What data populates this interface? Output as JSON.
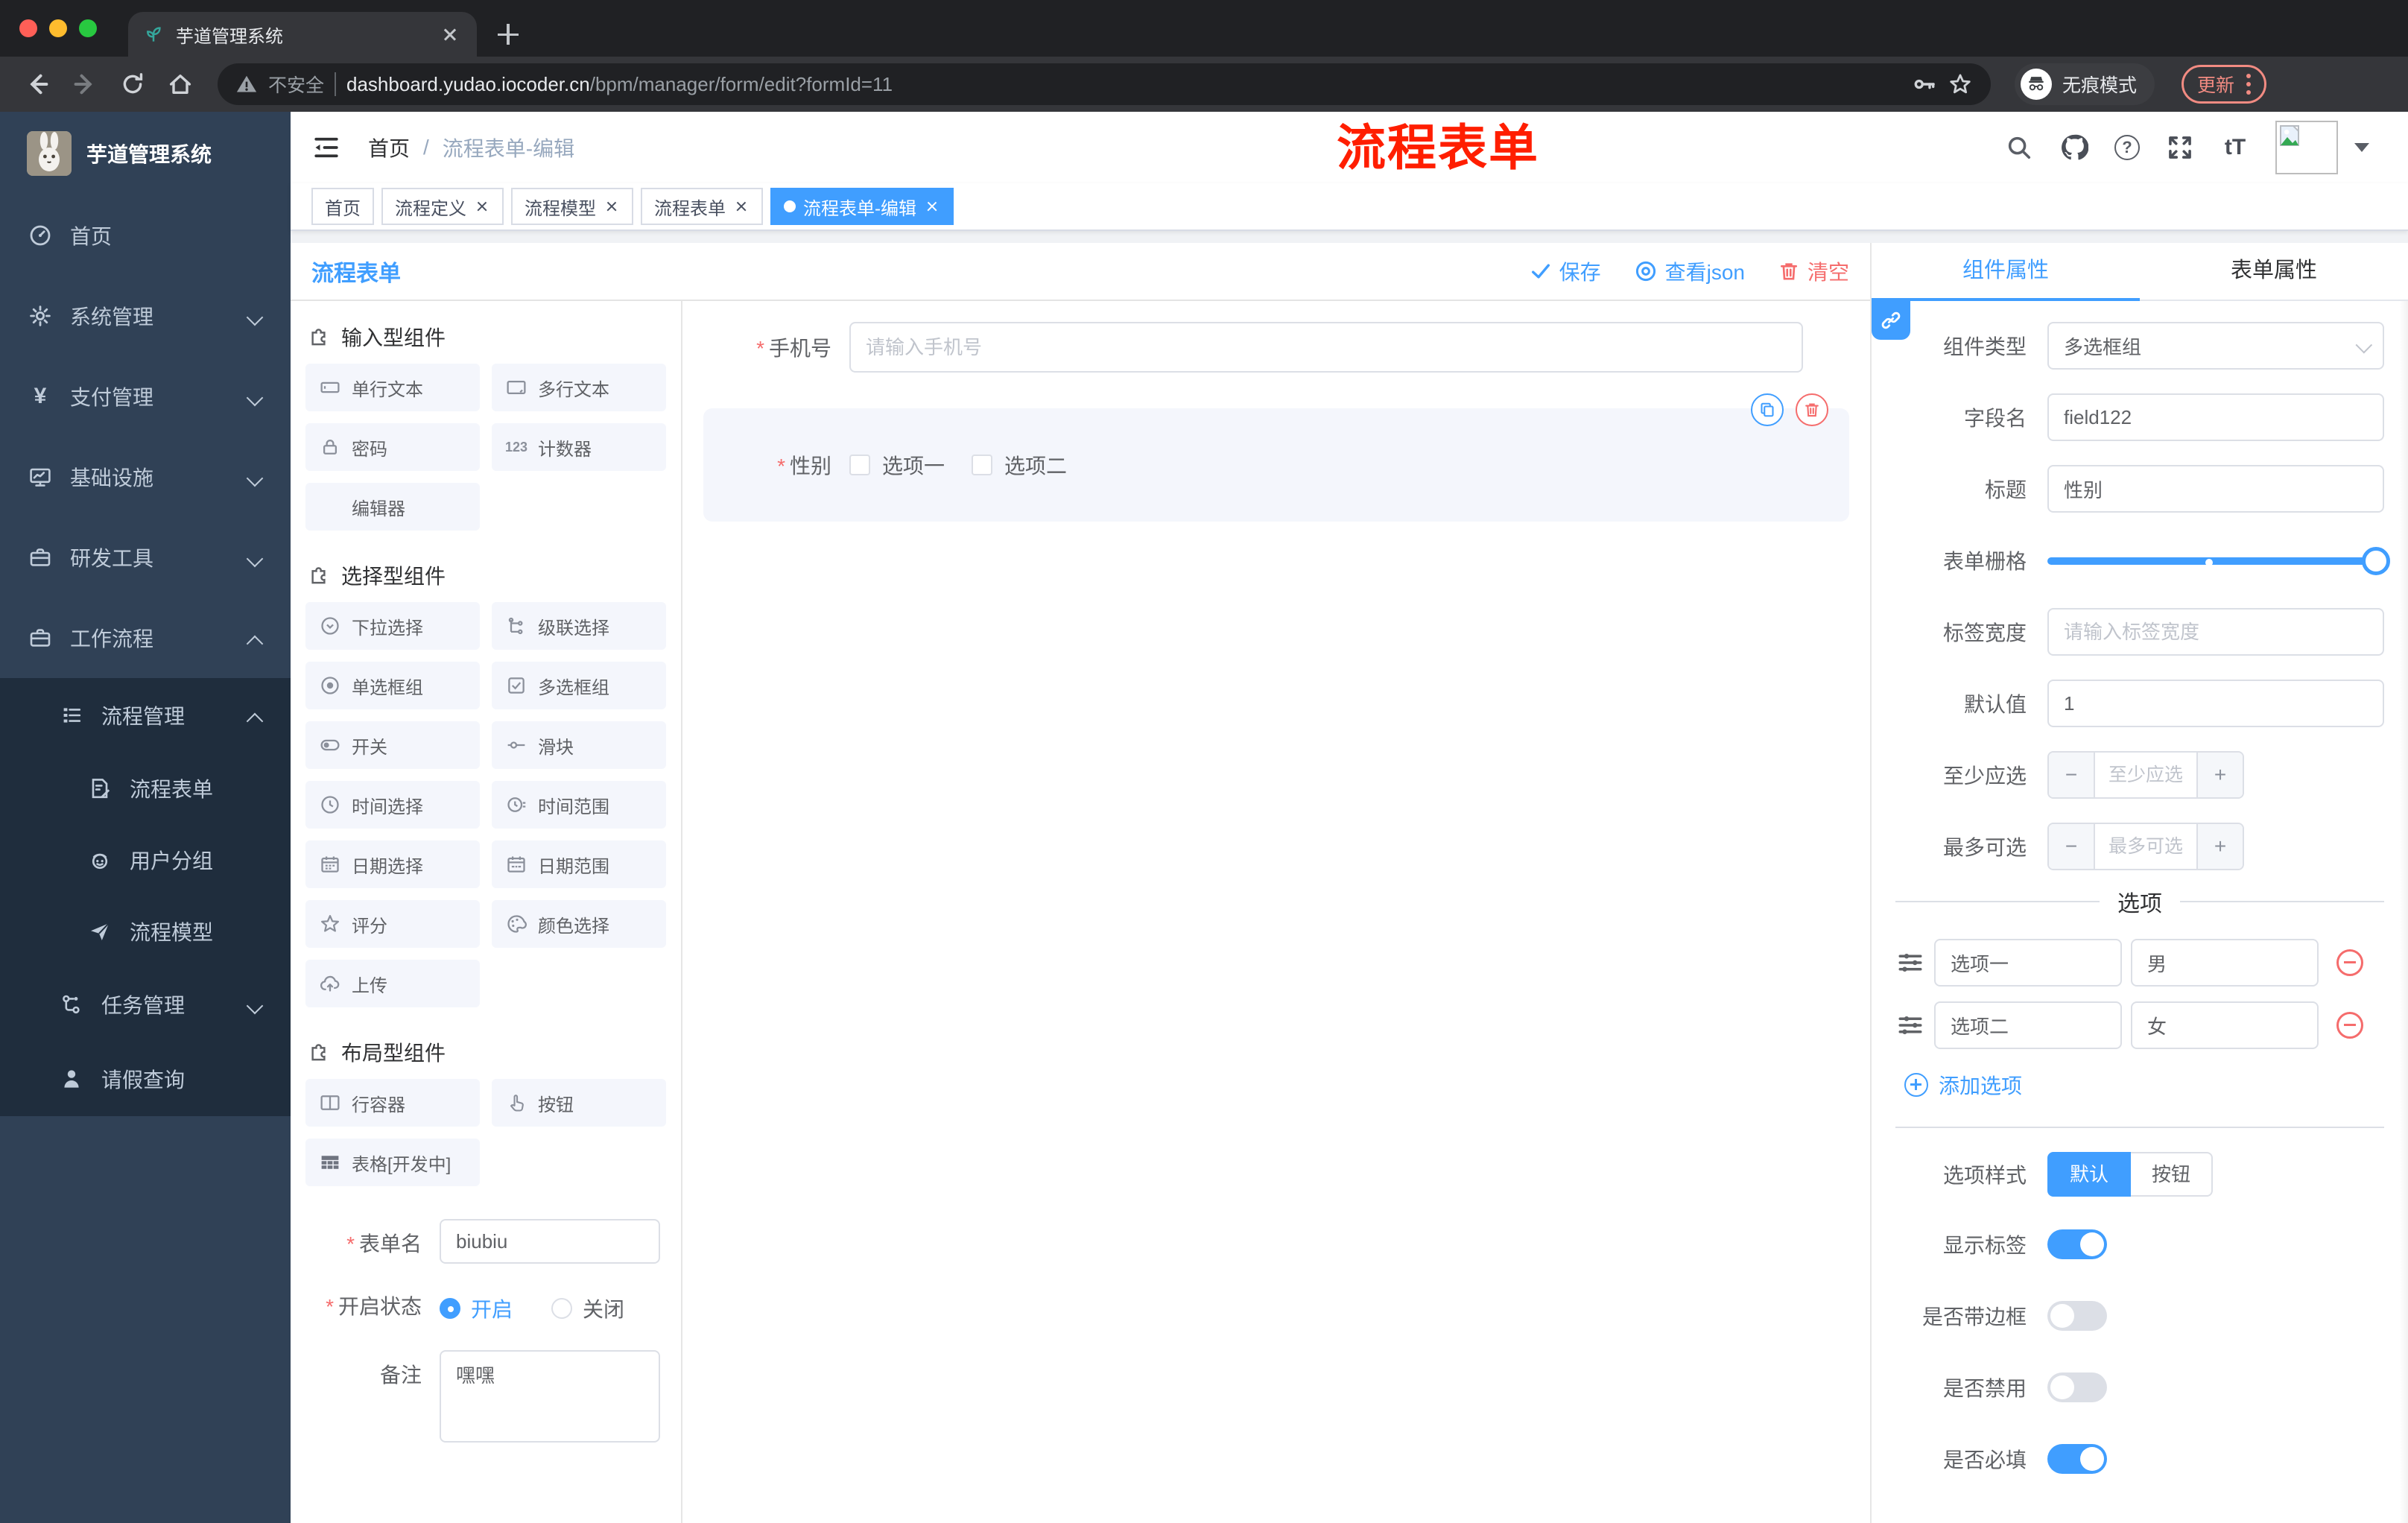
{
  "browser": {
    "tab_title": "芋道管理系统",
    "security_label": "不安全",
    "url_host": "dashboard.yudao.iocoder.cn",
    "url_path": "/bpm/manager/form/edit?formId=11",
    "incognito_label": "无痕模式",
    "update_label": "更新"
  },
  "sidebar": {
    "logo_title": "芋道管理系统",
    "items": [
      {
        "label": "首页",
        "icon": "dashboard-icon"
      },
      {
        "label": "系统管理",
        "icon": "gear-icon",
        "chevron": "down"
      },
      {
        "label": "支付管理",
        "icon": "yen-icon",
        "chevron": "down"
      },
      {
        "label": "基础设施",
        "icon": "monitor-icon",
        "chevron": "down"
      },
      {
        "label": "研发工具",
        "icon": "briefcase-icon",
        "chevron": "down"
      },
      {
        "label": "工作流程",
        "icon": "briefcase-icon",
        "chevron": "up"
      },
      {
        "label": "流程管理",
        "icon": "list-tree-icon",
        "chevron": "up",
        "level": 2
      },
      {
        "label": "流程表单",
        "icon": "form-doc-icon",
        "level": 3
      },
      {
        "label": "用户分组",
        "icon": "user-face-icon",
        "level": 3
      },
      {
        "label": "流程模型",
        "icon": "send-icon",
        "level": 3
      },
      {
        "label": "任务管理",
        "icon": "tree-icon",
        "chevron": "down",
        "level": 2
      },
      {
        "label": "请假查询",
        "icon": "person-icon",
        "level": 2
      }
    ]
  },
  "navbar": {
    "breadcrumb_home": "首页",
    "breadcrumb_sep": "/",
    "breadcrumb_current": "流程表单-编辑",
    "annotation": "流程表单",
    "help_glyph": "?",
    "text_size_glyph": "tT"
  },
  "tags": [
    {
      "label": "首页",
      "closable": false,
      "active": false
    },
    {
      "label": "流程定义",
      "closable": true,
      "active": false
    },
    {
      "label": "流程模型",
      "closable": true,
      "active": false
    },
    {
      "label": "流程表单",
      "closable": true,
      "active": false
    },
    {
      "label": "流程表单-编辑",
      "closable": true,
      "active": true
    }
  ],
  "toolbar": {
    "title": "流程表单",
    "save_label": "保存",
    "view_json_label": "查看json",
    "clear_label": "清空"
  },
  "components": {
    "sections": [
      {
        "title": "输入型组件",
        "items": [
          {
            "label": "单行文本",
            "icon": "input-icon"
          },
          {
            "label": "多行文本",
            "icon": "textarea-icon"
          },
          {
            "label": "密码",
            "icon": "lock-icon"
          },
          {
            "label": "计数器",
            "icon": "counter-123-icon"
          },
          {
            "label": "编辑器",
            "icon": "none"
          }
        ]
      },
      {
        "title": "选择型组件",
        "items": [
          {
            "label": "下拉选择",
            "icon": "select-icon"
          },
          {
            "label": "级联选择",
            "icon": "cascader-icon"
          },
          {
            "label": "单选框组",
            "icon": "radio-icon"
          },
          {
            "label": "多选框组",
            "icon": "checkbox-icon"
          },
          {
            "label": "开关",
            "icon": "switch-icon"
          },
          {
            "label": "滑块",
            "icon": "slider-icon"
          },
          {
            "label": "时间选择",
            "icon": "time-icon"
          },
          {
            "label": "时间范围",
            "icon": "time-range-icon"
          },
          {
            "label": "日期选择",
            "icon": "date-icon"
          },
          {
            "label": "日期范围",
            "icon": "date-range-icon"
          },
          {
            "label": "评分",
            "icon": "star-icon"
          },
          {
            "label": "颜色选择",
            "icon": "palette-icon"
          },
          {
            "label": "上传",
            "icon": "upload-icon"
          }
        ]
      },
      {
        "title": "布局型组件",
        "items": [
          {
            "label": "行容器",
            "icon": "row-container-icon"
          },
          {
            "label": "按钮",
            "icon": "button-hand-icon"
          },
          {
            "label": "表格[开发中]",
            "icon": "table-icon"
          }
        ]
      }
    ],
    "counter_glyph": "123",
    "meta": {
      "name_label": "表单名",
      "name_value": "biubiu",
      "status_label": "开启状态",
      "status_on": "开启",
      "status_off": "关闭",
      "remark_label": "备注",
      "remark_value": "嘿嘿"
    }
  },
  "canvas": {
    "phone_label": "手机号",
    "phone_placeholder": "请输入手机号",
    "gender_label": "性别",
    "gender_options": [
      "选项一",
      "选项二"
    ]
  },
  "props": {
    "tab_component": "组件属性",
    "tab_form": "表单属性",
    "type_label": "组件类型",
    "type_value": "多选框组",
    "field_label": "字段名",
    "field_value": "field122",
    "title_label": "标题",
    "title_value": "性别",
    "grid_label": "表单栅格",
    "label_width_label": "标签宽度",
    "label_width_placeholder": "请输入标签宽度",
    "default_label": "默认值",
    "default_value": "1",
    "min_label": "至少应选",
    "min_placeholder": "至少应选",
    "max_label": "最多可选",
    "max_placeholder": "最多可选",
    "stepper_minus": "−",
    "stepper_plus": "+",
    "options_divider": "选项",
    "options": [
      {
        "label": "选项一",
        "value": "男"
      },
      {
        "label": "选项二",
        "value": "女"
      }
    ],
    "add_option": "添加选项",
    "style_label": "选项样式",
    "style_default": "默认",
    "style_button": "按钮",
    "toggles": [
      {
        "label": "显示标签",
        "on": true
      },
      {
        "label": "是否带边框",
        "on": false
      },
      {
        "label": "是否禁用",
        "on": false
      },
      {
        "label": "是否必填",
        "on": true
      }
    ]
  },
  "colors": {
    "accent": "#409eff",
    "danger": "#f56c6c",
    "sidebar_bg": "#304156",
    "submenu_bg": "#1f2d3d",
    "annotation_red": "#ff1e00",
    "active_tag": "#409eff"
  }
}
